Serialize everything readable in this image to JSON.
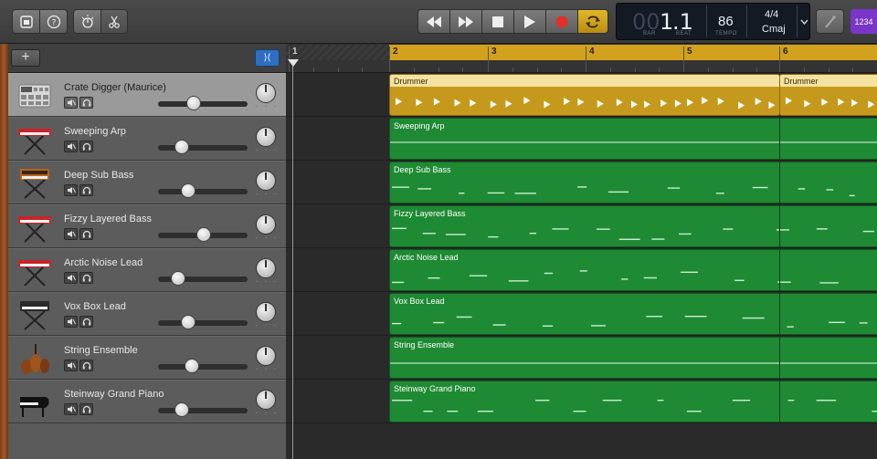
{
  "lcd": {
    "bar_dim": "00",
    "bar": "1",
    "beat": ".1",
    "bar_label": "BAR",
    "beat_label": "BEAT",
    "tempo": "86",
    "tempo_label": "TEMPO",
    "time_signature": "4/4",
    "key": "Cmaj"
  },
  "count_in": "1234",
  "colors": {
    "accent_blue": "#2e6fc1",
    "cycle_yellow": "#d2a21d",
    "region_green": "#1f8a34",
    "drummer_gold": "#c59a1c",
    "record_red": "#e0302a",
    "count_in_purple": "#7a35c9"
  },
  "toolbar": {
    "library_icon": "library-icon",
    "help_icon": "help-icon",
    "smart_controls_icon": "smart-controls-icon",
    "editors_icon": "scissors-icon",
    "rewind_icon": "rewind-icon",
    "fast_forward_icon": "fast-forward-icon",
    "stop_icon": "stop-icon",
    "play_icon": "play-icon",
    "record_icon": "record-icon",
    "cycle_icon": "cycle-icon",
    "tuner_icon": "tuner-icon"
  },
  "track_panel": {
    "add_label": "+",
    "smart_filter_label": "⟩⟨"
  },
  "ruler": {
    "bars": [
      "1",
      "2",
      "3",
      "4",
      "5",
      "6"
    ]
  },
  "tracks": [
    {
      "name": "Crate Digger (Maurice)",
      "instrument_icon": "drum-machine-icon",
      "volume": 0.4,
      "selected": true
    },
    {
      "name": "Sweeping Arp",
      "instrument_icon": "keyboard-red-icon",
      "volume": 0.27
    },
    {
      "name": "Deep Sub Bass",
      "instrument_icon": "synth-orange-icon",
      "volume": 0.34
    },
    {
      "name": "Fizzy Layered Bass",
      "instrument_icon": "keyboard-red-icon",
      "volume": 0.51
    },
    {
      "name": "Arctic Noise Lead",
      "instrument_icon": "keyboard-red-icon",
      "volume": 0.22
    },
    {
      "name": "Vox Box Lead",
      "instrument_icon": "keyboard-black-icon",
      "volume": 0.34
    },
    {
      "name": "String Ensemble",
      "instrument_icon": "strings-icon",
      "volume": 0.38
    },
    {
      "name": "Steinway Grand Piano",
      "instrument_icon": "grand-piano-icon",
      "volume": 0.27
    }
  ],
  "regions": [
    {
      "lane": 0,
      "name": "Drummer",
      "type": "drummer"
    },
    {
      "lane": 0,
      "name": "Drummer",
      "type": "drummer"
    },
    {
      "lane": 1,
      "name": "Sweeping Arp",
      "type": "midi"
    },
    {
      "lane": 2,
      "name": "Deep Sub Bass",
      "type": "midi"
    },
    {
      "lane": 3,
      "name": "Fizzy Layered Bass",
      "type": "midi"
    },
    {
      "lane": 4,
      "name": "Arctic Noise Lead",
      "type": "midi"
    },
    {
      "lane": 5,
      "name": "Vox Box Lead",
      "type": "midi"
    },
    {
      "lane": 6,
      "name": "String Ensemble",
      "type": "midi"
    },
    {
      "lane": 7,
      "name": "Steinway Grand Piano",
      "type": "midi"
    }
  ]
}
